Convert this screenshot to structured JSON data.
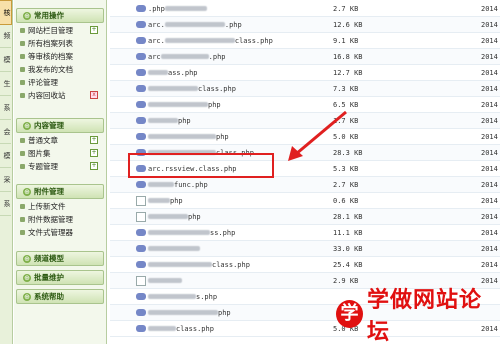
{
  "vertical_tabs": [
    "核",
    "频",
    "模",
    "生",
    "系",
    "会",
    "模",
    "采",
    "系"
  ],
  "sidebar": {
    "groups": [
      {
        "label": "常用操作",
        "items": [
          {
            "label": "网站栏目管理",
            "mini": "+"
          },
          {
            "label": "所有档案列表",
            "mini": ""
          },
          {
            "label": "等审核的档案",
            "mini": ""
          },
          {
            "label": "我发布的文档",
            "mini": ""
          },
          {
            "label": "评论管理",
            "mini": ""
          },
          {
            "label": "内容回收站",
            "mini": "x"
          }
        ]
      },
      {
        "label": "内容管理",
        "items": [
          {
            "label": "普通文章",
            "mini": "+"
          },
          {
            "label": "图片集",
            "mini": "+"
          },
          {
            "label": "专题管理",
            "mini": "+"
          }
        ]
      },
      {
        "label": "附件管理",
        "items": [
          {
            "label": "上传新文件",
            "mini": ""
          },
          {
            "label": "附件数据管理",
            "mini": ""
          },
          {
            "label": "文件式管理器",
            "mini": ""
          }
        ]
      },
      {
        "label": "频道模型",
        "items": []
      },
      {
        "label": "批量维护",
        "items": []
      },
      {
        "label": "系统帮助",
        "items": []
      }
    ]
  },
  "files": [
    {
      "name_visible": ".php",
      "size": "2.7 KB",
      "date": "2014"
    },
    {
      "name_visible": "arc.",
      "name_tail": ".php",
      "size": "12.6 KB",
      "date": "2014"
    },
    {
      "name_visible": "arc.",
      "name_tail": "class.php",
      "size": "9.1 KB",
      "date": "2014"
    },
    {
      "name_visible": "arc",
      "name_tail": ".php",
      "size": "16.8 KB",
      "date": "2014"
    },
    {
      "name_visible": "",
      "name_tail": "ass.php",
      "size": "12.7 KB",
      "date": "2014"
    },
    {
      "name_visible": "",
      "name_tail": "class.php",
      "size": "7.3 KB",
      "date": "2014"
    },
    {
      "name_visible": "",
      "name_tail": "php",
      "size": "6.5 KB",
      "date": "2014"
    },
    {
      "name_visible": "",
      "name_tail": "php",
      "size": "1.7 KB",
      "date": "2014"
    },
    {
      "name_visible": "",
      "name_tail": "php",
      "size": "5.0 KB",
      "date": "2014"
    },
    {
      "name_visible": "",
      "name_tail": "class.php",
      "size": "28.3 KB",
      "date": "2014"
    },
    {
      "name_visible": "arc.rssview.class.php",
      "name_tail": "",
      "size": "5.3 KB",
      "date": "2014"
    },
    {
      "name_visible": "",
      "name_tail": "func.php",
      "size": "2.7 KB",
      "date": "2014"
    },
    {
      "name_visible": "",
      "name_tail": "php",
      "size": "0.6 KB",
      "date": "2014"
    },
    {
      "name_visible": "",
      "name_tail": "php",
      "size": "28.1 KB",
      "date": "2014"
    },
    {
      "name_visible": "",
      "name_tail": "ss.php",
      "size": "11.1 KB",
      "date": "2014"
    },
    {
      "name_visible": "",
      "name_tail": "",
      "size": "33.0 KB",
      "date": "2014"
    },
    {
      "name_visible": "",
      "name_tail": "class.php",
      "size": "25.4 KB",
      "date": "2014"
    },
    {
      "name_visible": "",
      "name_tail": "",
      "size": "2.9 KB",
      "date": "2014"
    },
    {
      "name_visible": "",
      "name_tail": "s.php",
      "size": "",
      "date": ""
    },
    {
      "name_visible": "",
      "name_tail": "php",
      "size": "",
      "date": ""
    },
    {
      "name_visible": "",
      "name_tail": "class.php",
      "size": "5.0 KB",
      "date": "2014"
    }
  ],
  "watermark": {
    "glyph": "学",
    "text": "学做网站论坛"
  }
}
